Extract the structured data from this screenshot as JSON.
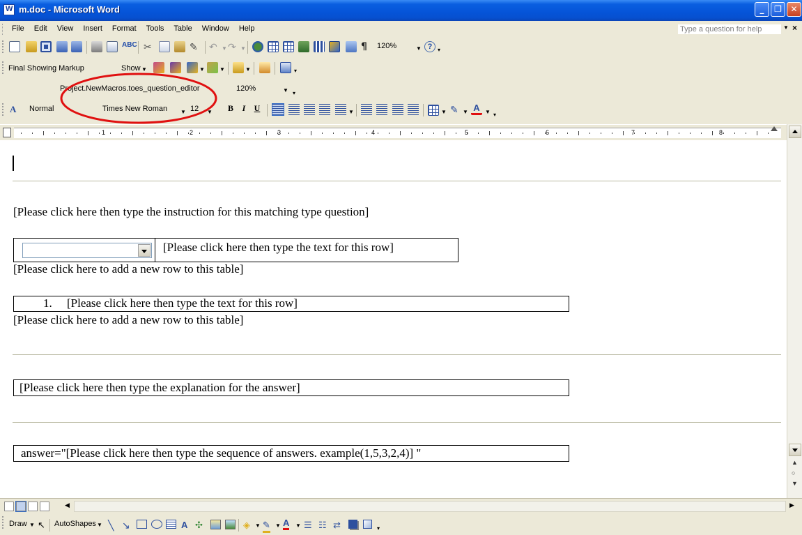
{
  "window": {
    "title": "m.doc - Microsoft Word",
    "minimize": "_",
    "maximize": "❐",
    "close": "✕"
  },
  "menu": {
    "items": [
      "File",
      "Edit",
      "View",
      "Insert",
      "Format",
      "Tools",
      "Table",
      "Window",
      "Help"
    ],
    "help_placeholder": "Type a question for help",
    "close": "×"
  },
  "standard_toolbar": {
    "icons": [
      "new-document-icon",
      "open-icon",
      "save-icon",
      "permission-icon",
      "print-icon",
      "print-preview-icon",
      "spelling-icon",
      "cut-icon",
      "copy-icon",
      "paste-icon",
      "format-painter-icon",
      "undo-icon",
      "redo-icon",
      "hyperlink-icon",
      "tables-borders-icon",
      "insert-table-icon",
      "insert-excel-icon",
      "columns-icon",
      "drawing-icon",
      "document-map-icon",
      "show-hide-icon",
      "help-icon"
    ],
    "zoom": "120%",
    "paragraph_mark": "¶",
    "help": "?"
  },
  "reviewing_toolbar": {
    "display_mode": "Final Showing Markup",
    "show_label": "Show"
  },
  "macro_toolbar": {
    "macro_name": "Project.NewMacros.toes_question_editor",
    "zoom": "120%"
  },
  "formatting_toolbar": {
    "style": "Normal",
    "font": "Times New Roman",
    "size": "12",
    "bold": "B",
    "italic": "I",
    "underline": "U",
    "font_color_glyph": "A"
  },
  "ruler": {
    "numbers": [
      "1",
      "2",
      "3",
      "4",
      "5",
      "6",
      "7",
      "8"
    ]
  },
  "document": {
    "instruction": "[Please click here then type the instruction for this matching type question]",
    "row_text": "[Please click here then type the text for this row]",
    "add_row_1": "[Please click here to add a new row to this table]",
    "list_number": "1.",
    "list_row_text": "[Please click here then type the text for this row]",
    "add_row_2": "[Please click here to add a new row to this table]",
    "explanation": "[Please click here then type the explanation for the answer]",
    "answer": "answer=\"[Please click here then type the sequence of answers. example(1,5,3,2,4)] \""
  },
  "drawing_toolbar": {
    "draw": "Draw",
    "autoshapes": "AutoShapes"
  },
  "annotation": {
    "color": "#e01010"
  }
}
